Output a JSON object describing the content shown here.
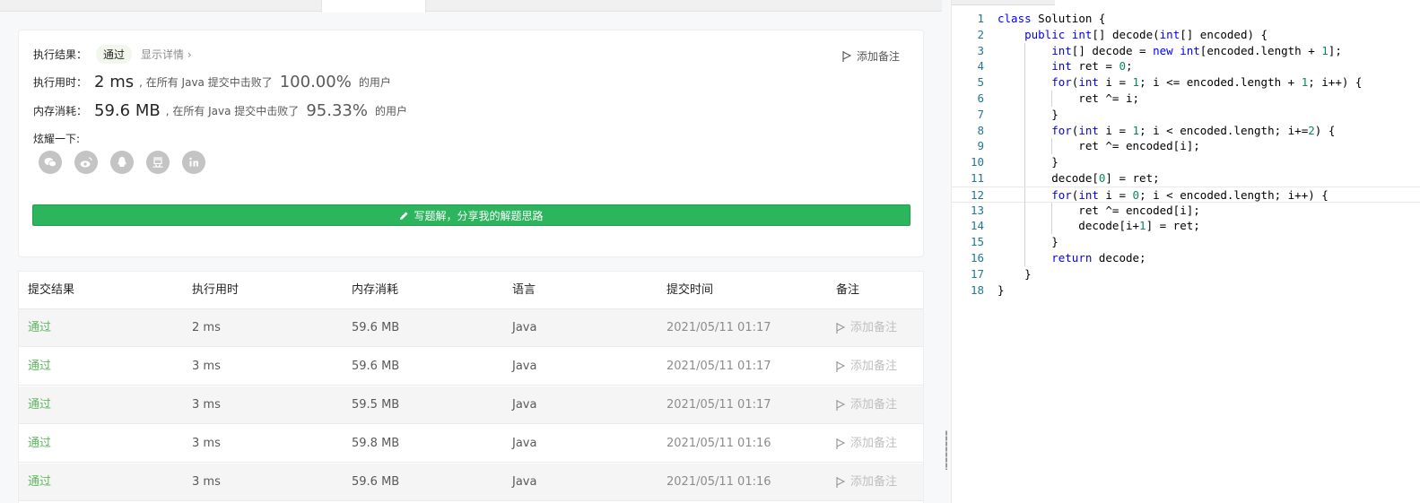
{
  "result": {
    "status_label": "执行结果：",
    "status_badge": "通过",
    "details_link": "显示详情 ›",
    "add_note": "添加备注",
    "runtime_label": "执行用时：",
    "runtime_value": "2 ms",
    "runtime_mid": ", 在所有 Java 提交中击败了",
    "runtime_pct": "100.00%",
    "runtime_tail": "的用户",
    "memory_label": "内存消耗：",
    "memory_value": "59.6 MB",
    "memory_mid": ", 在所有 Java 提交中击败了",
    "memory_pct": "95.33%",
    "memory_tail": "的用户",
    "share_label": "炫耀一下:",
    "share_icons": [
      "wechat-icon",
      "weibo-icon",
      "qq-icon",
      "douban-icon",
      "linkedin-icon"
    ],
    "write_button": "写题解，分享我的解题思路"
  },
  "submissions": {
    "headers": [
      "提交结果",
      "执行用时",
      "内存消耗",
      "语言",
      "提交时间",
      "备注"
    ],
    "rows": [
      {
        "status": "通过",
        "time": "2 ms",
        "memory": "59.6 MB",
        "lang": "Java",
        "submitted": "2021/05/11 01:17",
        "note": "添加备注"
      },
      {
        "status": "通过",
        "time": "3 ms",
        "memory": "59.6 MB",
        "lang": "Java",
        "submitted": "2021/05/11 01:17",
        "note": "添加备注"
      },
      {
        "status": "通过",
        "time": "3 ms",
        "memory": "59.5 MB",
        "lang": "Java",
        "submitted": "2021/05/11 01:17",
        "note": "添加备注"
      },
      {
        "status": "通过",
        "time": "3 ms",
        "memory": "59.8 MB",
        "lang": "Java",
        "submitted": "2021/05/11 01:16",
        "note": "添加备注"
      },
      {
        "status": "通过",
        "time": "3 ms",
        "memory": "59.6 MB",
        "lang": "Java",
        "submitted": "2021/05/11 01:16",
        "note": "添加备注"
      }
    ]
  },
  "editor": {
    "current_line": 12,
    "lines": [
      "class Solution {",
      "    public int[] decode(int[] encoded) {",
      "        int[] decode = new int[encoded.length + 1];",
      "        int ret = 0;",
      "        for(int i = 1; i <= encoded.length + 1; i++) {",
      "            ret ^= i;",
      "        }",
      "        for(int i = 1; i < encoded.length; i+=2) {",
      "            ret ^= encoded[i];",
      "        }",
      "        decode[0] = ret;",
      "        for(int i = 0; i < encoded.length; i++) {",
      "            ret ^= encoded[i];",
      "            decode[i+1] = ret;",
      "        }",
      "        return decode;",
      "    }",
      "}"
    ]
  },
  "colors": {
    "accent_green": "#2db55d",
    "pass_green": "#5cb85c",
    "keyword_blue": "#0000ff",
    "number_green": "#09885a",
    "line_number": "#237893"
  }
}
